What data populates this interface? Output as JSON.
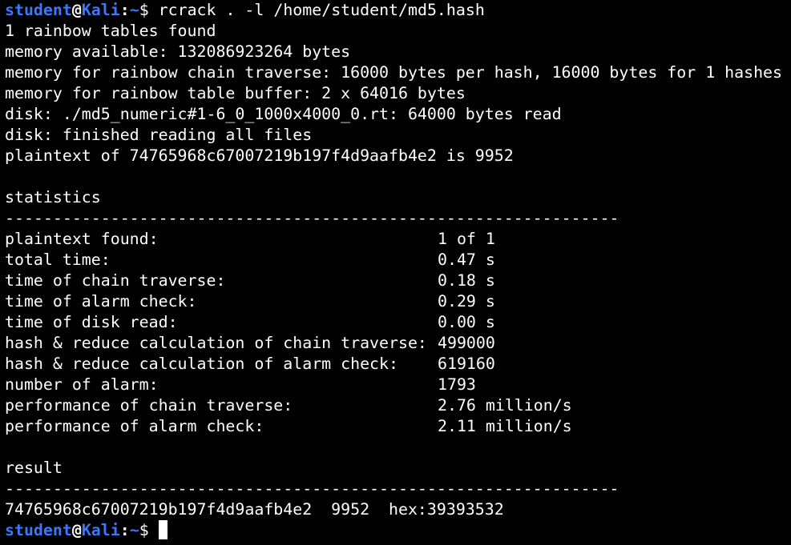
{
  "prompt": {
    "user": "student",
    "at": "@",
    "host": "Kali",
    "colon": ":",
    "path": "~",
    "symbol": "$"
  },
  "command": " rcrack . -l /home/student/md5.hash",
  "output_lines": [
    "1 rainbow tables found",
    "memory available: 132086923264 bytes",
    "memory for rainbow chain traverse: 16000 bytes per hash, 16000 bytes for 1 hashes",
    "memory for rainbow table buffer: 2 x 64016 bytes",
    "disk: ./md5_numeric#1-6_0_1000x4000_0.rt: 64000 bytes read",
    "disk: finished reading all files",
    "plaintext of 74765968c67007219b197f4d9aafb4e2 is 9952"
  ],
  "statistics": {
    "heading": "statistics",
    "separator": "----------------------------------------------------------------",
    "rows": [
      {
        "label": "plaintext found:",
        "value": "1 of 1"
      },
      {
        "label": "total time:",
        "value": "0.47 s"
      },
      {
        "label": "time of chain traverse:",
        "value": "0.18 s"
      },
      {
        "label": "time of alarm check:",
        "value": "0.29 s"
      },
      {
        "label": "time of disk read:",
        "value": "0.00 s"
      },
      {
        "label": "hash & reduce calculation of chain traverse:",
        "value": "499000"
      },
      {
        "label": "hash & reduce calculation of alarm check:",
        "value": "619160"
      },
      {
        "label": "number of alarm:",
        "value": "1793"
      },
      {
        "label": "performance of chain traverse:",
        "value": "2.76 million/s"
      },
      {
        "label": "performance of alarm check:",
        "value": "2.11 million/s"
      }
    ]
  },
  "result": {
    "heading": "result",
    "separator": "----------------------------------------------------------------",
    "line": "74765968c67007219b197f4d9aafb4e2  9952  hex:39393532"
  },
  "colors": {
    "background": "#000000",
    "text": "#ffffff",
    "prompt_accent": "#3b78ff"
  }
}
